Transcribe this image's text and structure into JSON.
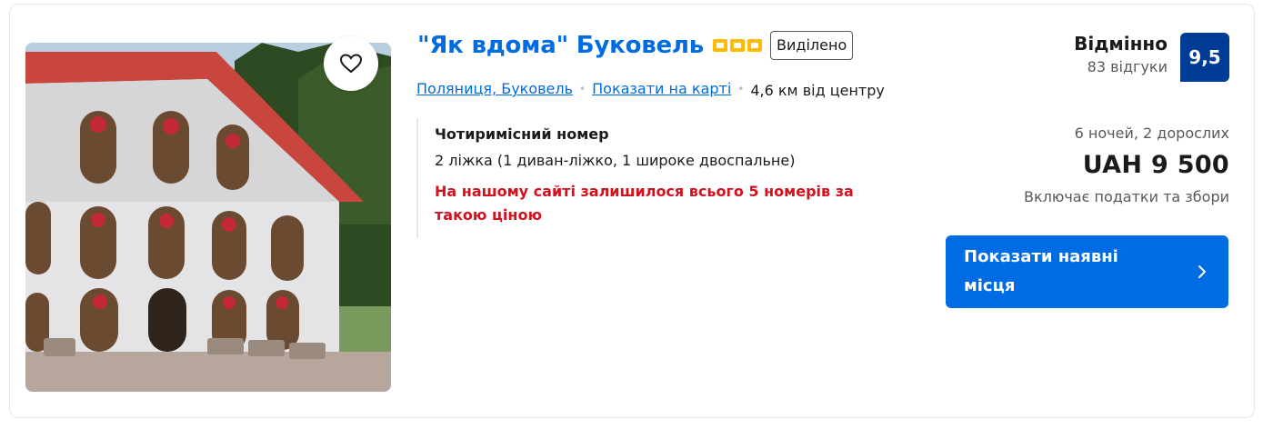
{
  "hotel": {
    "name": "\"Як вдома\" Буковель",
    "badge": "Виділено",
    "stars": 3,
    "location_link": "Поляниця, Буковель",
    "map_link": "Показати на карті",
    "distance": "4,6 км від центру"
  },
  "room": {
    "name": "Чотиримісний номер",
    "beds": "2 ліжка (1 диван-ліжко, 1 широке двоспальне)",
    "availability_warning": "На нашому сайті залишилося всього 5 номерів за такою ціною"
  },
  "review": {
    "word": "Відмінно",
    "count": "83 відгуки",
    "score": "9,5"
  },
  "price": {
    "stay": "6 ночей, 2 дорослих",
    "amount": "UAH 9 500",
    "taxes": "Включає податки та збори"
  },
  "cta": {
    "label": "Показати наявні місця"
  },
  "icons": {
    "favorite": "heart-icon",
    "cta_arrow": "chevron-right-icon",
    "star": "star-square-icon"
  },
  "colors": {
    "link": "#006ce4",
    "score_bg": "#003b95",
    "warning": "#d4111e",
    "star": "#febb02",
    "cta_bg": "#006ce4"
  }
}
